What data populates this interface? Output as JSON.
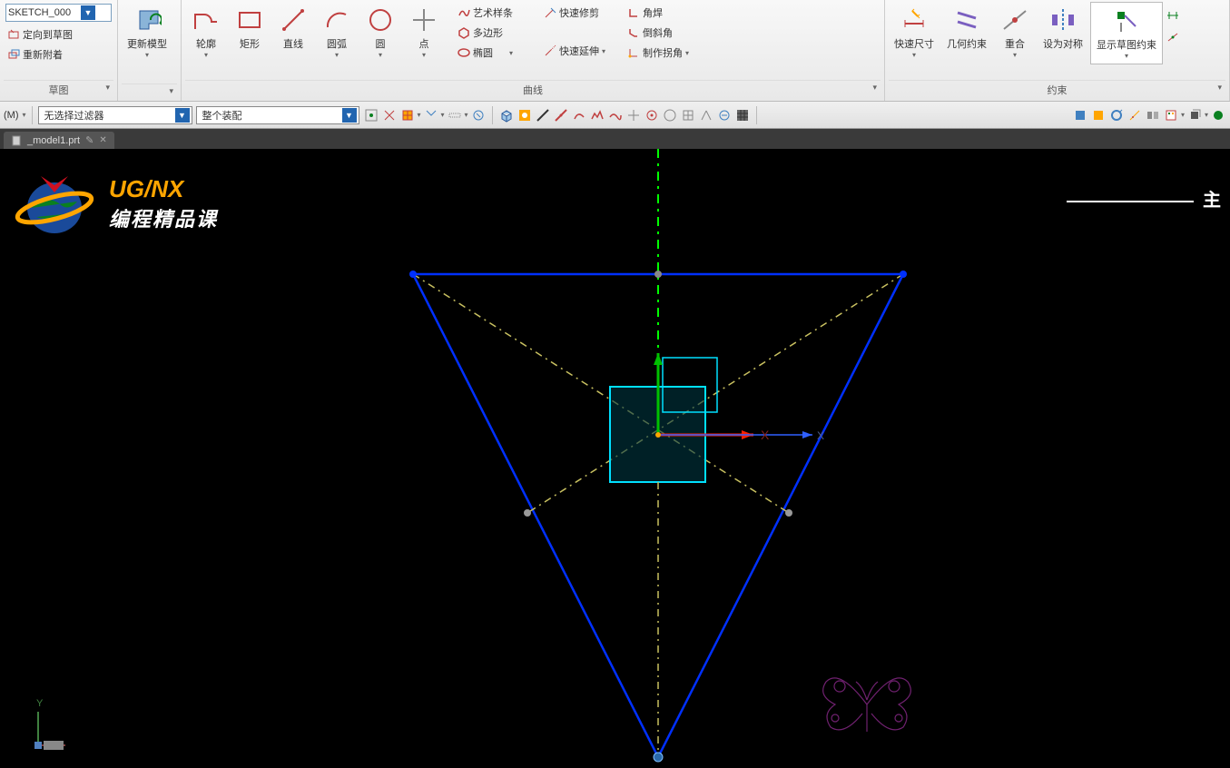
{
  "sketchName": "SKETCH_000",
  "ribbon": {
    "group1": {
      "orient": "定向到草图",
      "reattach": "重新附着",
      "label": "草图"
    },
    "updateModel": "更新模型",
    "tools": {
      "profile": "轮廓",
      "rect": "矩形",
      "line": "直线",
      "arc": "圆弧",
      "circle": "圆",
      "point": "点"
    },
    "col1": {
      "artStyle": "艺术样条",
      "polygon": "多边形",
      "ellipse": "椭圆"
    },
    "col2": {
      "quickTrim": "快速修剪",
      "quickExtend": "快速延伸"
    },
    "col3": {
      "cornerWeld": "角焊",
      "chamfer": "倒斜角",
      "makeCorner": "制作拐角"
    },
    "curveLabel": "曲线",
    "constraint": {
      "rapidDim": "快速尺寸",
      "geoConstraint": "几何约束",
      "coincide": "重合",
      "makeSymmetric": "设为对称",
      "showConstraints": "显示草图约束",
      "label": "约束"
    }
  },
  "filterBar": {
    "m": "(M)",
    "noFilter": "无选择过滤器",
    "wholeAssembly": "整个装配"
  },
  "fileTab": "_model1.prt",
  "logo": {
    "line1": "UG/NX",
    "line2": "编程精品课"
  },
  "topRight": "主",
  "axes": {
    "x": "X",
    "y": "Y"
  },
  "triad": {
    "y": "Y"
  }
}
